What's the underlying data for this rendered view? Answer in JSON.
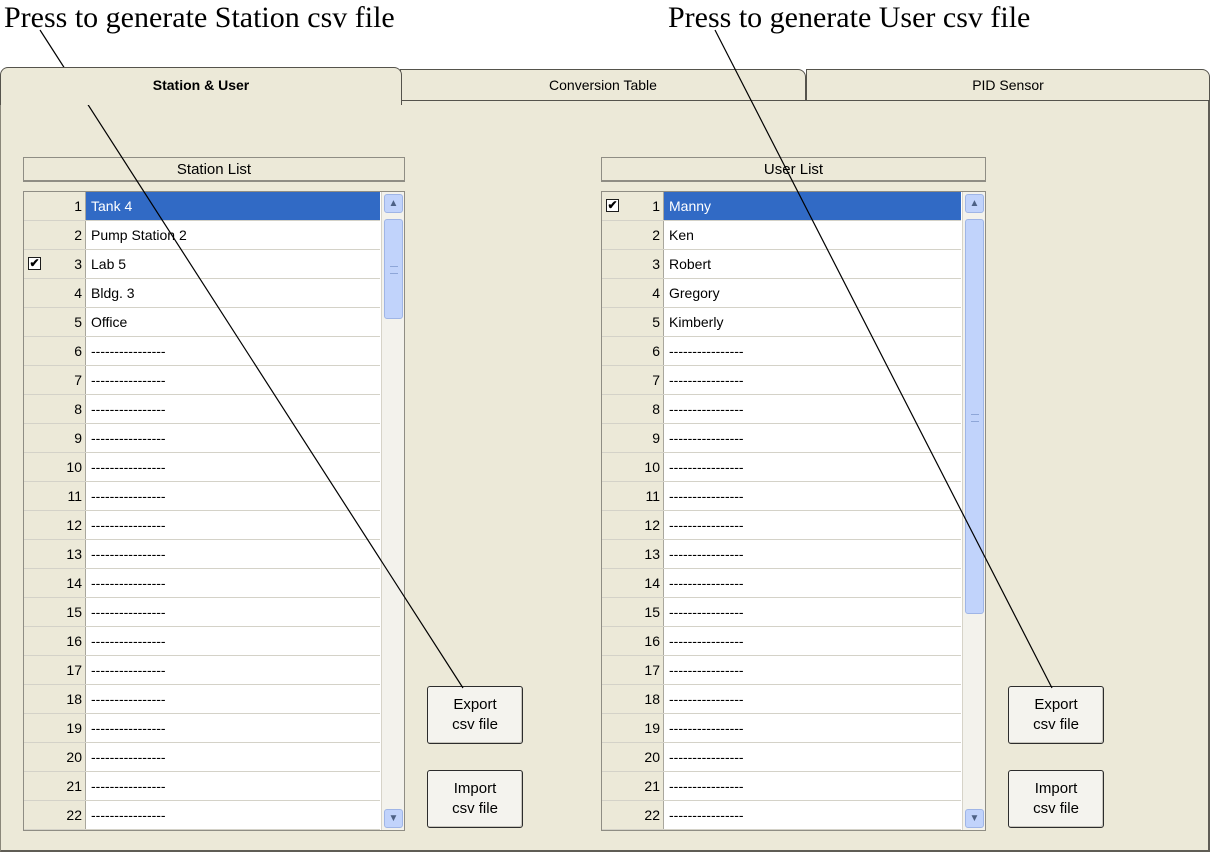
{
  "callouts": {
    "station": "Press to generate Station csv file",
    "user": "Press to generate User csv file"
  },
  "tabs": [
    "Station & User",
    "Conversion Table",
    "PID Sensor"
  ],
  "station_list": {
    "header": "Station List",
    "rows": [
      {
        "num": "1",
        "name": "Tank 4",
        "checked": false,
        "selected": true
      },
      {
        "num": "2",
        "name": "Pump Station 2",
        "checked": false,
        "selected": false
      },
      {
        "num": "3",
        "name": "Lab 5",
        "checked": true,
        "selected": false
      },
      {
        "num": "4",
        "name": "Bldg. 3",
        "checked": false,
        "selected": false
      },
      {
        "num": "5",
        "name": "Office",
        "checked": false,
        "selected": false
      },
      {
        "num": "6",
        "name": "----------------",
        "checked": false,
        "selected": false
      },
      {
        "num": "7",
        "name": "----------------",
        "checked": false,
        "selected": false
      },
      {
        "num": "8",
        "name": "----------------",
        "checked": false,
        "selected": false
      },
      {
        "num": "9",
        "name": "----------------",
        "checked": false,
        "selected": false
      },
      {
        "num": "10",
        "name": "----------------",
        "checked": false,
        "selected": false
      },
      {
        "num": "11",
        "name": "----------------",
        "checked": false,
        "selected": false
      },
      {
        "num": "12",
        "name": "----------------",
        "checked": false,
        "selected": false
      },
      {
        "num": "13",
        "name": "----------------",
        "checked": false,
        "selected": false
      },
      {
        "num": "14",
        "name": "----------------",
        "checked": false,
        "selected": false
      },
      {
        "num": "15",
        "name": "----------------",
        "checked": false,
        "selected": false
      },
      {
        "num": "16",
        "name": "----------------",
        "checked": false,
        "selected": false
      },
      {
        "num": "17",
        "name": "----------------",
        "checked": false,
        "selected": false
      },
      {
        "num": "18",
        "name": "----------------",
        "checked": false,
        "selected": false
      },
      {
        "num": "19",
        "name": "----------------",
        "checked": false,
        "selected": false
      },
      {
        "num": "20",
        "name": "----------------",
        "checked": false,
        "selected": false
      },
      {
        "num": "21",
        "name": "----------------",
        "checked": false,
        "selected": false
      },
      {
        "num": "22",
        "name": "----------------",
        "checked": false,
        "selected": false
      }
    ]
  },
  "user_list": {
    "header": "User List",
    "rows": [
      {
        "num": "1",
        "name": "Manny",
        "checked": true,
        "selected": true
      },
      {
        "num": "2",
        "name": "Ken",
        "checked": false,
        "selected": false
      },
      {
        "num": "3",
        "name": "Robert",
        "checked": false,
        "selected": false
      },
      {
        "num": "4",
        "name": "Gregory",
        "checked": false,
        "selected": false
      },
      {
        "num": "5",
        "name": "Kimberly",
        "checked": false,
        "selected": false
      },
      {
        "num": "6",
        "name": "----------------",
        "checked": false,
        "selected": false
      },
      {
        "num": "7",
        "name": "----------------",
        "checked": false,
        "selected": false
      },
      {
        "num": "8",
        "name": "----------------",
        "checked": false,
        "selected": false
      },
      {
        "num": "9",
        "name": "----------------",
        "checked": false,
        "selected": false
      },
      {
        "num": "10",
        "name": "----------------",
        "checked": false,
        "selected": false
      },
      {
        "num": "11",
        "name": "----------------",
        "checked": false,
        "selected": false
      },
      {
        "num": "12",
        "name": "----------------",
        "checked": false,
        "selected": false
      },
      {
        "num": "13",
        "name": "----------------",
        "checked": false,
        "selected": false
      },
      {
        "num": "14",
        "name": "----------------",
        "checked": false,
        "selected": false
      },
      {
        "num": "15",
        "name": "----------------",
        "checked": false,
        "selected": false
      },
      {
        "num": "16",
        "name": "----------------",
        "checked": false,
        "selected": false
      },
      {
        "num": "17",
        "name": "----------------",
        "checked": false,
        "selected": false
      },
      {
        "num": "18",
        "name": "----------------",
        "checked": false,
        "selected": false
      },
      {
        "num": "19",
        "name": "----------------",
        "checked": false,
        "selected": false
      },
      {
        "num": "20",
        "name": "----------------",
        "checked": false,
        "selected": false
      },
      {
        "num": "21",
        "name": "----------------",
        "checked": false,
        "selected": false
      },
      {
        "num": "22",
        "name": "----------------",
        "checked": false,
        "selected": false
      }
    ]
  },
  "buttons": {
    "export_line1": "Export",
    "export_line2": "csv file",
    "import_line1": "Import",
    "import_line2": "csv file"
  },
  "colors": {
    "panel": "#ece9d8",
    "selection": "#316ac5",
    "scrollbar": "#c1d3fb"
  },
  "icons": {
    "scroll_up": "chevron-up-icon",
    "scroll_down": "chevron-down-icon",
    "checkbox": "checkmark-icon"
  }
}
